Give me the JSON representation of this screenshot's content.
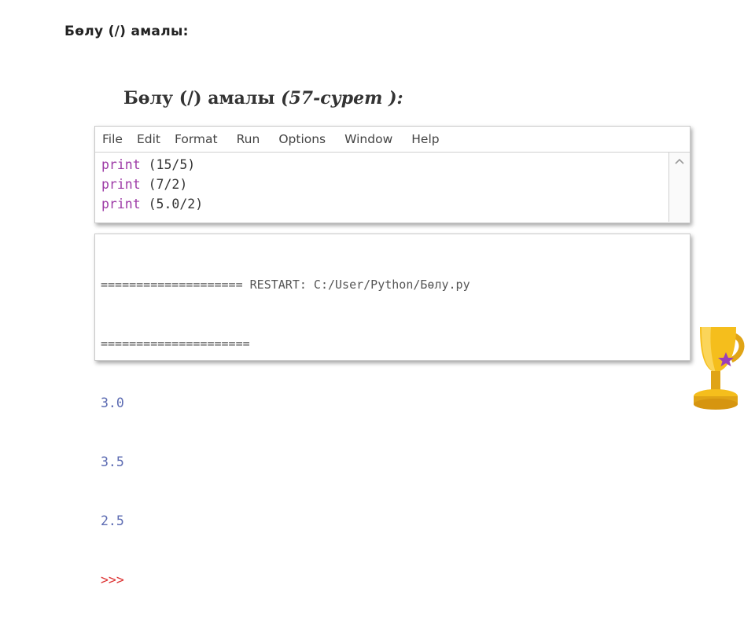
{
  "slide": {
    "title": "Бөлу (/) амалы:"
  },
  "figure": {
    "caption_main": "Бөлу (/) амалы ",
    "caption_ref": "(57-сурет ):"
  },
  "editor": {
    "menu": [
      "File",
      "Edit",
      "Format",
      "Run",
      "Options",
      "Window",
      "Help"
    ],
    "lines": [
      {
        "keyword": "print",
        "arg": "(15/5)"
      },
      {
        "keyword": "print",
        "arg": "(7/2)"
      },
      {
        "keyword": "print",
        "arg": "(5.0/2)"
      }
    ]
  },
  "shell": {
    "restart_line": "==================== RESTART: C:/User/Python/Бөлу.py",
    "separator": "=====================",
    "outputs": [
      "3.0",
      "3.5",
      "2.5"
    ],
    "prompt": ">>>"
  },
  "colors": {
    "keyword": "#9d3aa6",
    "output": "#5c6bb2",
    "prompt": "#dd3333",
    "trophy": "#f2b81a"
  },
  "icons": {
    "trophy": "trophy-icon",
    "scroll_up": "chevron-up-icon"
  }
}
